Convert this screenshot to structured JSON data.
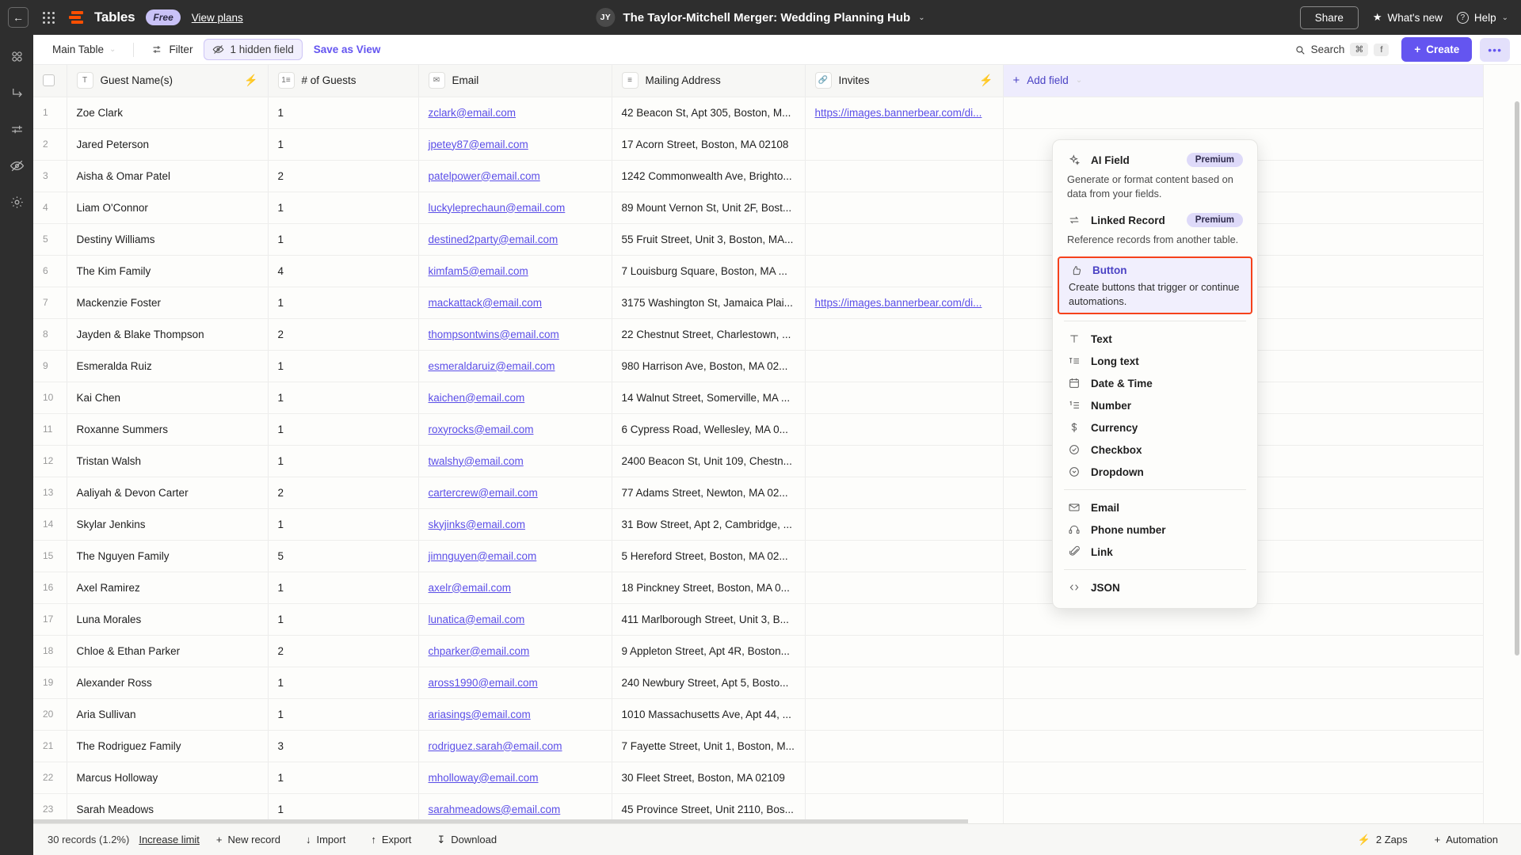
{
  "topbar": {
    "back_icon": "arrow-left-icon",
    "apps_icon": "app-grid-icon",
    "brand": "Tables",
    "plan_badge": "Free",
    "view_plans": "View plans",
    "avatar_initials": "JY",
    "doc_title": "The Taylor-Mitchell Merger: Wedding Planning Hub",
    "title_chevron": "⌄",
    "share_label": "Share",
    "whats_new_label": "What's new",
    "help_label": "Help",
    "help_chevron": "⌄"
  },
  "left_rail": [
    {
      "name": "records-icon"
    },
    {
      "name": "transfer-icon"
    },
    {
      "name": "filter-sliders-icon"
    },
    {
      "name": "hidden-eye-icon"
    },
    {
      "name": "settings-gear-icon"
    }
  ],
  "toolbar": {
    "view_name": "Main Table",
    "view_chevron": "⌄",
    "filter_label": "Filter",
    "hidden_field_label": "1 hidden field",
    "save_as_view_label": "Save as View",
    "search_label": "Search",
    "search_kbd_1": "⌘",
    "search_kbd_2": "f",
    "create_label": "Create",
    "create_plus": "+",
    "more_label": "•••"
  },
  "grid": {
    "columns": [
      {
        "label": "Guest Name(s)",
        "icon": "text-field-icon",
        "icon_glyph": "T",
        "bolt": true
      },
      {
        "label": "# of Guests",
        "icon": "number-field-icon",
        "icon_glyph": "1≡",
        "bolt": false
      },
      {
        "label": "Email",
        "icon": "email-field-icon",
        "icon_glyph": "✉",
        "bolt": false
      },
      {
        "label": "Mailing Address",
        "icon": "long-text-field-icon",
        "icon_glyph": "ᴛ≡",
        "bolt": false
      },
      {
        "label": "Invites",
        "icon": "link-field-icon",
        "icon_glyph": "ὑ7",
        "bolt": true
      }
    ],
    "add_field_label": "Add field",
    "add_field_chevron": "⌄",
    "rows": [
      {
        "n": "1",
        "name": "Zoe Clark",
        "guests": "1",
        "email": "zclark@email.com",
        "address": "42 Beacon St, Apt 305, Boston, M...",
        "invite": "https://images.bannerbear.com/di..."
      },
      {
        "n": "2",
        "name": "Jared Peterson",
        "guests": "1",
        "email": "jpetey87@email.com",
        "address": "17 Acorn Street, Boston, MA 02108",
        "invite": ""
      },
      {
        "n": "3",
        "name": "Aisha & Omar Patel",
        "guests": "2",
        "email": "patelpower@email.com",
        "address": "1242 Commonwealth Ave, Brighto...",
        "invite": ""
      },
      {
        "n": "4",
        "name": "Liam O'Connor",
        "guests": "1",
        "email": "luckyleprechaun@email.com",
        "address": "89 Mount Vernon St, Unit 2F, Bost...",
        "invite": ""
      },
      {
        "n": "5",
        "name": "Destiny Williams",
        "guests": "1",
        "email": "destined2party@email.com",
        "address": "55 Fruit Street, Unit 3, Boston, MA...",
        "invite": ""
      },
      {
        "n": "6",
        "name": "The Kim Family",
        "guests": "4",
        "email": "kimfam5@email.com",
        "address": "7 Louisburg Square, Boston, MA ...",
        "invite": ""
      },
      {
        "n": "7",
        "name": "Mackenzie Foster",
        "guests": "1",
        "email": "mackattack@email.com",
        "address": "3175 Washington St, Jamaica Plai...",
        "invite": "https://images.bannerbear.com/di..."
      },
      {
        "n": "8",
        "name": "Jayden & Blake Thompson",
        "guests": "2",
        "email": "thompsontwins@email.com",
        "address": "22 Chestnut Street, Charlestown, ...",
        "invite": ""
      },
      {
        "n": "9",
        "name": "Esmeralda Ruiz",
        "guests": "1",
        "email": "esmeraldaruiz@email.com",
        "address": "980 Harrison Ave, Boston, MA 02...",
        "invite": ""
      },
      {
        "n": "10",
        "name": "Kai Chen",
        "guests": "1",
        "email": "kaichen@email.com",
        "address": "14 Walnut Street, Somerville, MA ...",
        "invite": ""
      },
      {
        "n": "11",
        "name": "Roxanne Summers",
        "guests": "1",
        "email": "roxyrocks@email.com",
        "address": "6 Cypress Road, Wellesley, MA 0...",
        "invite": ""
      },
      {
        "n": "12",
        "name": "Tristan Walsh",
        "guests": "1",
        "email": "twalshy@email.com",
        "address": "2400 Beacon St, Unit 109, Chestn...",
        "invite": ""
      },
      {
        "n": "13",
        "name": "Aaliyah & Devon Carter",
        "guests": "2",
        "email": "cartercrew@email.com",
        "address": "77 Adams Street, Newton, MA 02...",
        "invite": ""
      },
      {
        "n": "14",
        "name": "Skylar Jenkins",
        "guests": "1",
        "email": "skyjinks@email.com",
        "address": "31 Bow Street, Apt 2, Cambridge, ...",
        "invite": ""
      },
      {
        "n": "15",
        "name": "The Nguyen Family",
        "guests": "5",
        "email": "jimnguyen@email.com",
        "address": "5 Hereford Street, Boston, MA 02...",
        "invite": ""
      },
      {
        "n": "16",
        "name": "Axel Ramirez",
        "guests": "1",
        "email": "axelr@email.com",
        "address": "18 Pinckney Street, Boston, MA 0...",
        "invite": ""
      },
      {
        "n": "17",
        "name": "Luna Morales",
        "guests": "1",
        "email": "lunatica@email.com",
        "address": "411 Marlborough Street, Unit 3, B...",
        "invite": ""
      },
      {
        "n": "18",
        "name": "Chloe & Ethan Parker",
        "guests": "2",
        "email": "chparker@email.com",
        "address": "9 Appleton Street, Apt 4R, Boston...",
        "invite": ""
      },
      {
        "n": "19",
        "name": "Alexander Ross",
        "guests": "1",
        "email": "aross1990@email.com",
        "address": "240 Newbury Street, Apt 5, Bosto...",
        "invite": ""
      },
      {
        "n": "20",
        "name": "Aria Sullivan",
        "guests": "1",
        "email": "ariasings@email.com",
        "address": "1010 Massachusetts Ave, Apt 44, ...",
        "invite": ""
      },
      {
        "n": "21",
        "name": "The Rodriguez Family",
        "guests": "3",
        "email": "rodriguez.sarah@email.com",
        "address": "7 Fayette Street, Unit 1, Boston, M...",
        "invite": ""
      },
      {
        "n": "22",
        "name": "Marcus Holloway",
        "guests": "1",
        "email": "mholloway@email.com",
        "address": "30 Fleet Street, Boston, MA 02109",
        "invite": ""
      },
      {
        "n": "23",
        "name": "Sarah Meadows",
        "guests": "1",
        "email": "sarahmeadows@email.com",
        "address": "45 Province Street, Unit 2110, Bos...",
        "invite": ""
      }
    ]
  },
  "field_menu": {
    "ai_field": {
      "label": "AI Field",
      "badge": "Premium",
      "desc": "Generate or format content based on data from your fields."
    },
    "linked_record": {
      "label": "Linked Record",
      "badge": "Premium",
      "desc": "Reference records from another table."
    },
    "button": {
      "label": "Button",
      "desc": "Create buttons that trigger or continue automations."
    },
    "group2": [
      {
        "label": "Text",
        "icon": "text-icon"
      },
      {
        "label": "Long text",
        "icon": "long-text-icon"
      },
      {
        "label": "Date & Time",
        "icon": "calendar-icon"
      },
      {
        "label": "Number",
        "icon": "number-icon"
      },
      {
        "label": "Currency",
        "icon": "dollar-icon"
      },
      {
        "label": "Checkbox",
        "icon": "check-circle-icon"
      },
      {
        "label": "Dropdown",
        "icon": "chevron-circle-icon"
      }
    ],
    "group3": [
      {
        "label": "Email",
        "icon": "envelope-icon"
      },
      {
        "label": "Phone number",
        "icon": "headset-icon"
      },
      {
        "label": "Link",
        "icon": "paperclip-icon"
      }
    ],
    "group4": [
      {
        "label": "JSON",
        "icon": "code-brackets-icon"
      }
    ]
  },
  "footer": {
    "records_text": "30 records (1.2%)",
    "increase_limit": "Increase limit",
    "new_record": "New record",
    "import": "Import",
    "export": "Export",
    "download": "Download",
    "zaps": "2 Zaps",
    "automation": "Automation"
  },
  "colors": {
    "accent_purple": "#6455f0",
    "zapier_orange": "#ff4f00",
    "highlight_red": "#f5421b",
    "topbar_dark": "#2e2e2e"
  }
}
